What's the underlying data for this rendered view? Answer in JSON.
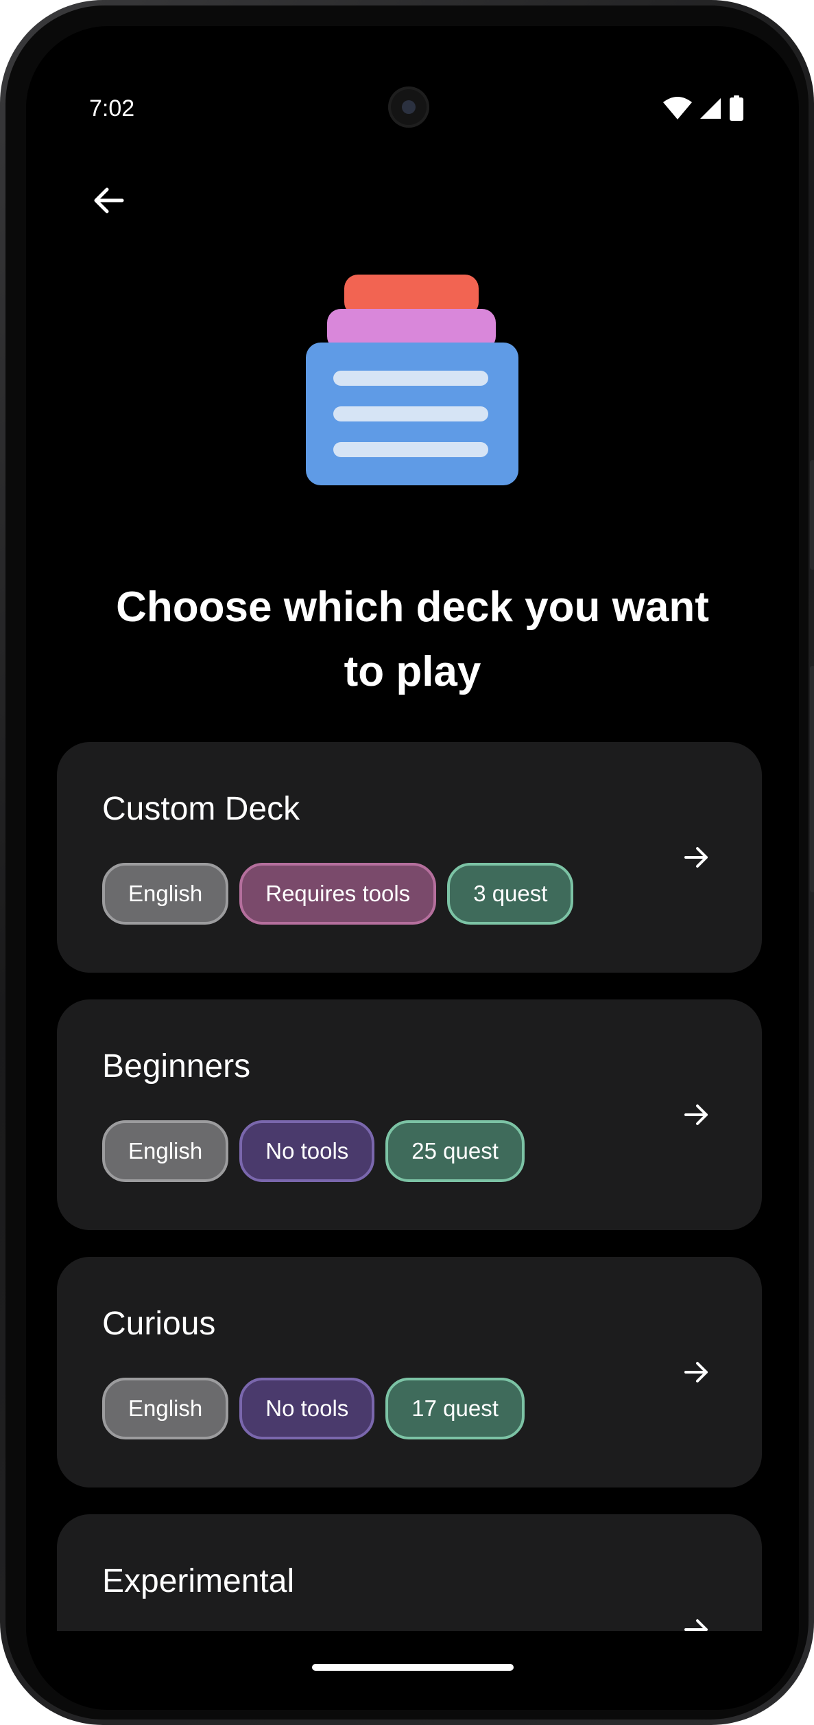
{
  "status_bar": {
    "time": "7:02",
    "icons": [
      "wifi-icon",
      "signal-icon",
      "battery-icon"
    ]
  },
  "header": {
    "back_icon": "arrow-left-icon"
  },
  "illustration": {
    "icon": "card-deck-icon",
    "colors": {
      "top_card": "#f26452",
      "middle_card": "#d987da",
      "front_card": "#5f9be6",
      "lines": "#d6e4f5"
    }
  },
  "title": "Choose which deck you want to play",
  "decks": [
    {
      "name": "Custom Deck",
      "language": "English",
      "tools": "Requires tools",
      "tools_type": "required",
      "questions": "3 quest"
    },
    {
      "name": "Beginners",
      "language": "English",
      "tools": "No tools",
      "tools_type": "none",
      "questions": "25 quest"
    },
    {
      "name": "Curious",
      "language": "English",
      "tools": "No tools",
      "tools_type": "none",
      "questions": "17 quest"
    },
    {
      "name": "Experimental"
    }
  ],
  "colors": {
    "background": "#000000",
    "card": "#1c1c1d",
    "chip_language": "#6b6b6d",
    "chip_requires_tools": "#7a4a6b",
    "chip_no_tools": "#4a3a6c",
    "chip_questions": "#3f6b5b"
  }
}
